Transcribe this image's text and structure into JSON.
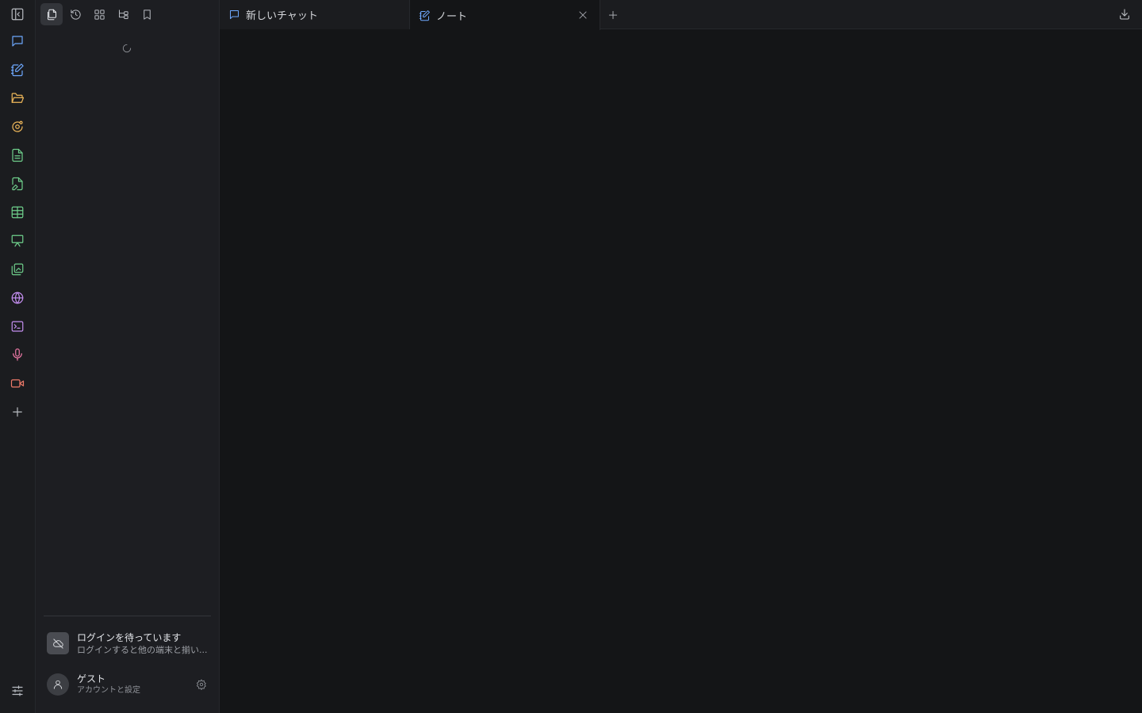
{
  "rail": {
    "items": [
      {
        "icon": "sidebar-toggle-icon",
        "color": "#b8bbc1"
      },
      {
        "icon": "chat-icon",
        "color": "#6ea8fe"
      },
      {
        "icon": "note-edit-icon",
        "color": "#6ea8fe"
      },
      {
        "icon": "folder-open-icon",
        "color": "#f0b85a"
      },
      {
        "icon": "orbit-icon",
        "color": "#f0b85a"
      },
      {
        "icon": "document-icon",
        "color": "#6fd08c"
      },
      {
        "icon": "file-edit-icon",
        "color": "#6fd08c"
      },
      {
        "icon": "table-icon",
        "color": "#6fd08c"
      },
      {
        "icon": "presentation-icon",
        "color": "#6fd08c"
      },
      {
        "icon": "image-edit-icon",
        "color": "#6fd08c"
      },
      {
        "icon": "globe-icon",
        "color": "#c48ef0"
      },
      {
        "icon": "terminal-icon",
        "color": "#c48ef0"
      },
      {
        "icon": "microphone-icon",
        "color": "#f07aa8"
      },
      {
        "icon": "video-icon",
        "color": "#f07a6a"
      },
      {
        "icon": "plus-icon",
        "color": "#b8bbc1"
      }
    ],
    "bottom_icon": "sliders-icon"
  },
  "panel": {
    "toolbar": [
      {
        "icon": "files-icon",
        "active": true
      },
      {
        "icon": "history-icon",
        "active": false
      },
      {
        "icon": "grid-icon",
        "active": false
      },
      {
        "icon": "tree-icon",
        "active": false
      },
      {
        "icon": "bookmark-icon",
        "active": false
      }
    ],
    "login": {
      "title": "ログインを待っています",
      "subtitle": "ログインすると他の端末と揃い..."
    },
    "account": {
      "name": "ゲスト",
      "subtitle": "アカウントと設定"
    }
  },
  "tabs": [
    {
      "label": "新しいチャット",
      "icon": "chat-icon",
      "color": "#6ea8fe",
      "active": false
    },
    {
      "label": "ノート",
      "icon": "note-edit-icon",
      "color": "#6ea8fe",
      "active": true
    }
  ]
}
